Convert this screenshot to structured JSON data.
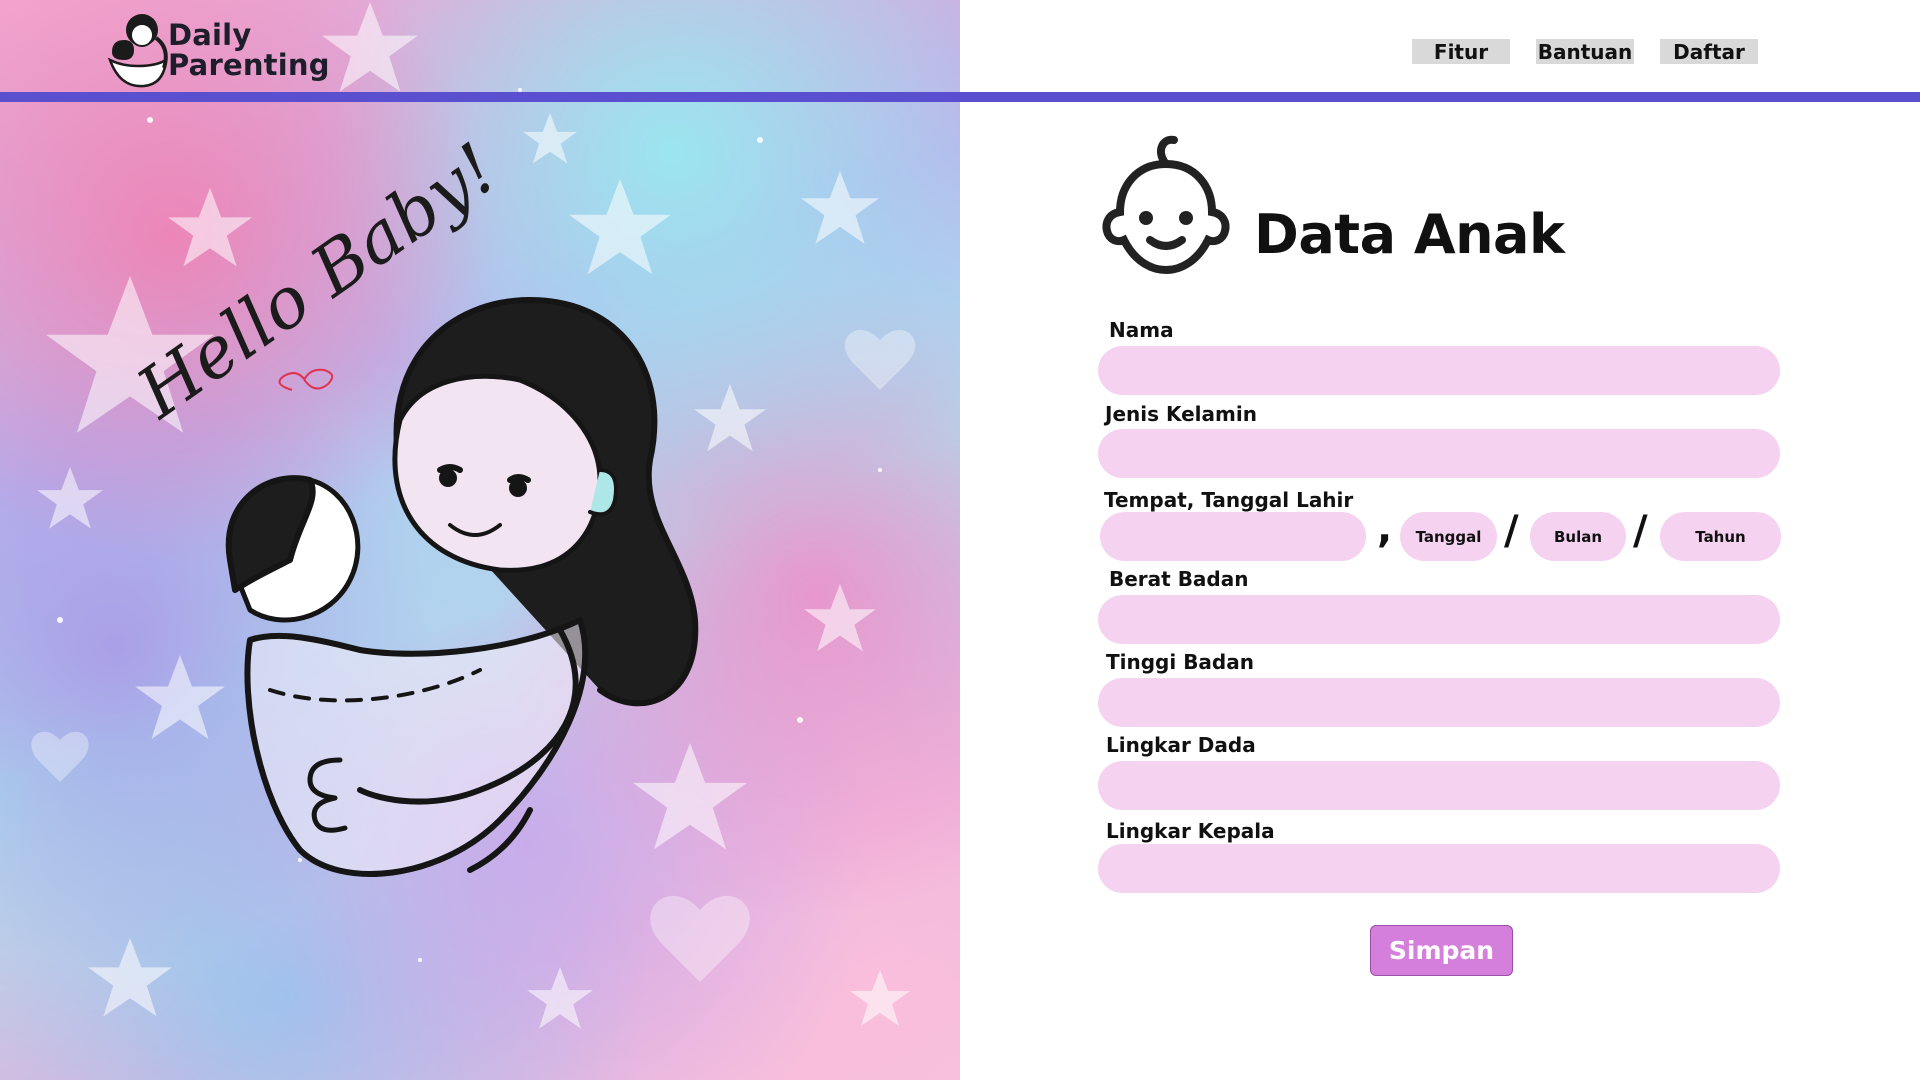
{
  "app": {
    "logo_line1": "Daily",
    "logo_line2": "Parenting",
    "hero_text": "Hello Baby!"
  },
  "nav": {
    "items": [
      "Fitur",
      "Bantuan",
      "Daftar"
    ]
  },
  "form": {
    "title": "Data Anak",
    "fields": {
      "nama": {
        "label": "Nama",
        "value": ""
      },
      "jenis_kelamin": {
        "label": "Jenis Kelamin",
        "value": ""
      },
      "ttl": {
        "label": "Tempat, Tanggal Lahir",
        "tempat_value": "",
        "comma": ",",
        "slash": "/",
        "tanggal_placeholder": "Tanggal",
        "bulan_placeholder": "Bulan",
        "tahun_placeholder": "Tahun"
      },
      "berat_badan": {
        "label": "Berat Badan",
        "value": ""
      },
      "tinggi_badan": {
        "label": "Tinggi Badan",
        "value": ""
      },
      "lingkar_dada": {
        "label": "Lingkar Dada",
        "value": ""
      },
      "lingkar_kepala": {
        "label": "Lingkar Kepala",
        "value": ""
      }
    },
    "submit_label": "Simpan"
  },
  "colors": {
    "accent_bar": "#5a4fcf",
    "input_bg": "#f6d2f1",
    "submit_bg": "#d47fdc",
    "nav_bg": "#d9d9d9"
  },
  "icons": {
    "logo": "mother-baby-logo-icon",
    "form": "baby-face-icon"
  }
}
